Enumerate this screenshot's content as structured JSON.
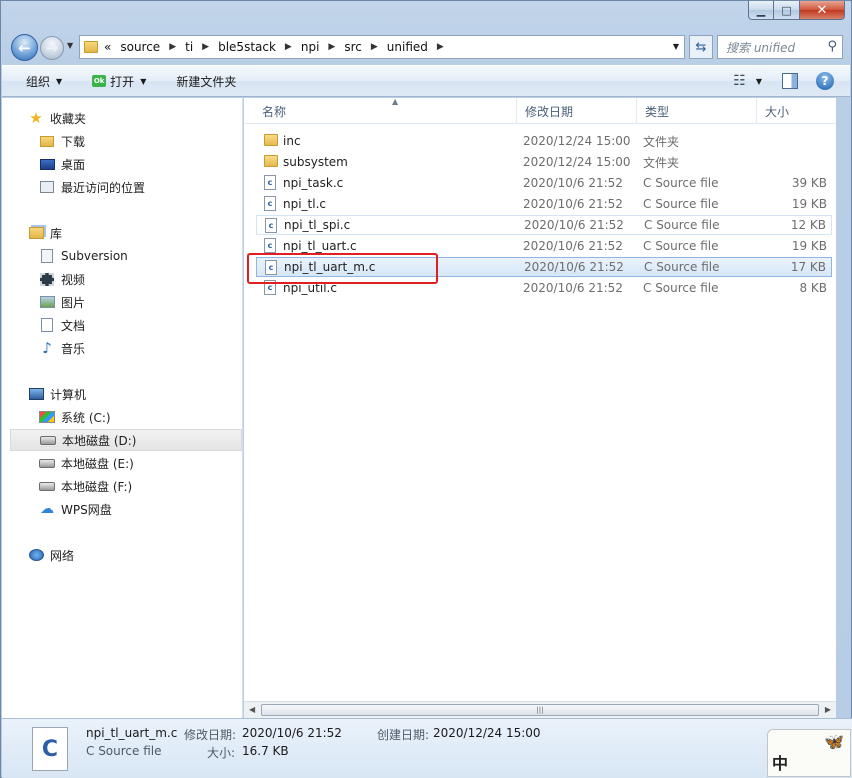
{
  "window": {
    "min_glyph": "▁",
    "max_glyph": "□",
    "close_glyph": "✕"
  },
  "nav": {
    "back_glyph": "←",
    "forward_glyph": "→",
    "breadcrumb_lead": "«",
    "breadcrumbs": [
      "source",
      "ti",
      "ble5stack",
      "npi",
      "src",
      "unified"
    ],
    "search_placeholder": "搜索 unified"
  },
  "toolbar": {
    "organize": "组织",
    "open": "打开",
    "new_folder": "新建文件夹",
    "open_badge": "Ok"
  },
  "sidebar": {
    "favorites": {
      "label": "收藏夹",
      "items": [
        "下载",
        "桌面",
        "最近访问的位置"
      ]
    },
    "libraries": {
      "label": "库",
      "items": [
        "Subversion",
        "视频",
        "图片",
        "文档",
        "音乐"
      ]
    },
    "computer": {
      "label": "计算机",
      "items": [
        "系统 (C:)",
        "本地磁盘 (D:)",
        "本地磁盘 (E:)",
        "本地磁盘 (F:)",
        "WPS网盘"
      ],
      "selected": "本地磁盘 (D:)"
    },
    "network": {
      "label": "网络"
    }
  },
  "columns": {
    "name": "名称",
    "date": "修改日期",
    "type": "类型",
    "size": "大小"
  },
  "files": [
    {
      "name": "inc",
      "date": "2020/12/24 15:00",
      "type": "文件夹",
      "size": "",
      "kind": "folder"
    },
    {
      "name": "subsystem",
      "date": "2020/12/24 15:00",
      "type": "文件夹",
      "size": "",
      "kind": "folder"
    },
    {
      "name": "npi_task.c",
      "date": "2020/10/6 21:52",
      "type": "C Source file",
      "size": "39 KB",
      "kind": "c"
    },
    {
      "name": "npi_tl.c",
      "date": "2020/10/6 21:52",
      "type": "C Source file",
      "size": "19 KB",
      "kind": "c"
    },
    {
      "name": "npi_tl_spi.c",
      "date": "2020/10/6 21:52",
      "type": "C Source file",
      "size": "12 KB",
      "kind": "c"
    },
    {
      "name": "npi_tl_uart.c",
      "date": "2020/10/6 21:52",
      "type": "C Source file",
      "size": "19 KB",
      "kind": "c"
    },
    {
      "name": "npi_tl_uart_m.c",
      "date": "2020/10/6 21:52",
      "type": "C Source file",
      "size": "17 KB",
      "kind": "c"
    },
    {
      "name": "npi_util.c",
      "date": "2020/10/6 21:52",
      "type": "C Source file",
      "size": "8 KB",
      "kind": "c"
    }
  ],
  "selected_file": "npi_tl_uart_m.c",
  "details": {
    "icon_letter": "C",
    "name": "npi_tl_uart_m.c",
    "type": "C Source file",
    "modified_label": "修改日期:",
    "modified_value": "2020/10/6 21:52",
    "size_label": "大小:",
    "size_value": "16.7 KB",
    "created_label": "创建日期:",
    "created_value": "2020/12/24 15:00"
  },
  "ime": {
    "mode": "中"
  },
  "colors": {
    "highlight_box": "#e02020",
    "selection_border": "#8fb7e0",
    "accent": "#2b5fa6"
  }
}
